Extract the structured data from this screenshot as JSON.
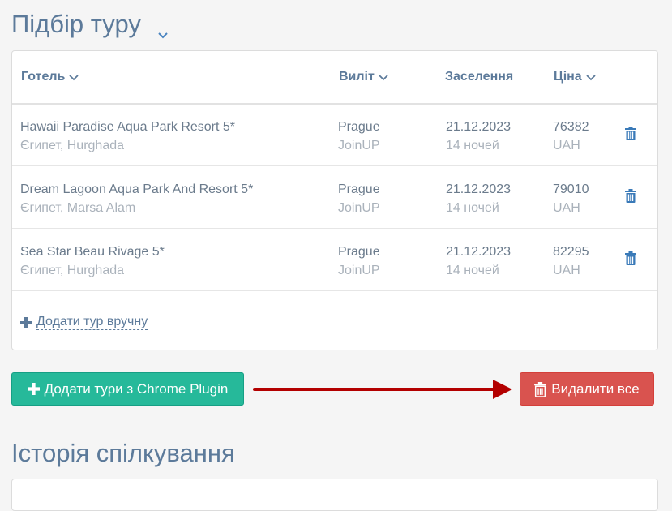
{
  "tour_section": {
    "title": "Підбір туру",
    "columns": {
      "hotel": "Готель",
      "departure": "Виліт",
      "checkin": "Заселення",
      "price": "Ціна"
    },
    "rows": [
      {
        "hotel": "Hawaii Paradise Aqua Park Resort 5*",
        "location": "Єгипет, Hurghada",
        "city": "Prague",
        "operator": "JoinUP",
        "date": "21.12.2023",
        "nights": "14 ночей",
        "price": "76382",
        "currency": "UAH"
      },
      {
        "hotel": "Dream Lagoon Aqua Park And Resort 5*",
        "location": "Єгипет, Marsa Alam",
        "city": "Prague",
        "operator": "JoinUP",
        "date": "21.12.2023",
        "nights": "14 ночей",
        "price": "79010",
        "currency": "UAH"
      },
      {
        "hotel": "Sea Star Beau Rivage 5*",
        "location": "Єгипет, Hurghada",
        "city": "Prague",
        "operator": "JoinUP",
        "date": "21.12.2023",
        "nights": "14 ночей",
        "price": "82295",
        "currency": "UAH"
      }
    ],
    "add_manual_label": "Додати тур вручну",
    "add_plugin_label": "Додати тури з Chrome Plugin",
    "delete_all_label": "Видалити все"
  },
  "history_section": {
    "title": "Історія спілкування"
  },
  "colors": {
    "heading": "#5c7a9a",
    "green_button": "#26b99a",
    "red_button": "#d9534f",
    "arrow": "#b30000",
    "trash_icon": "#3a7ab8"
  },
  "icons": {
    "collapse": "chevron-down-icon",
    "sort": "chevron-down-icon",
    "delete_row": "trash-icon",
    "add": "plus-icon",
    "annotation": "red-arrow"
  }
}
